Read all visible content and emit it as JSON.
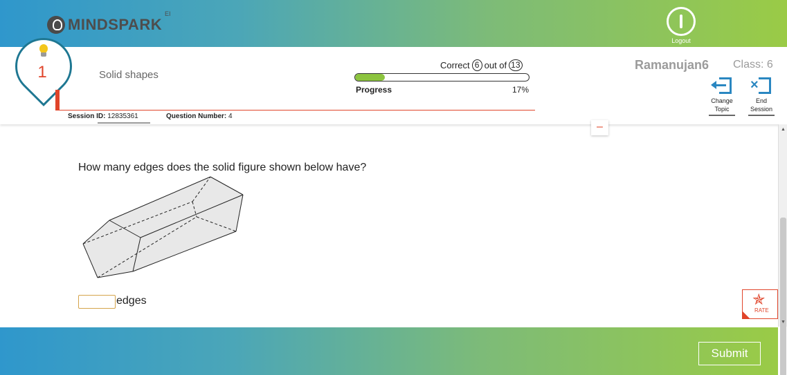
{
  "brand": {
    "name": "MINDSPARK",
    "superscript": "EI"
  },
  "header": {
    "logout_label": "Logout"
  },
  "topic": {
    "badge_number": "1",
    "name": "Solid shapes"
  },
  "session": {
    "session_label": "Session ID:",
    "session_id": "12835361",
    "question_label": "Question Number:",
    "question_number": "4"
  },
  "score": {
    "correct_label": "Correct",
    "correct": "6",
    "out_of_label": "out of",
    "total": "13"
  },
  "progress": {
    "label": "Progress",
    "percent_text": "17%",
    "fraction": 0.17
  },
  "user": {
    "name": "Ramanujan6",
    "class_text": "Class: 6"
  },
  "actions": {
    "change_topic_line1": "Change",
    "change_topic_line2": "Topic",
    "end_session_line1": "End",
    "end_session_line2": "Session"
  },
  "collapse_symbol": "–",
  "question": {
    "text": "How many edges does the solid figure shown below have?",
    "answer_value": "",
    "unit": "edges"
  },
  "rate": {
    "label": "RATE"
  },
  "footer": {
    "submit_label": "Submit"
  },
  "colors": {
    "accent_red": "#e0442a",
    "brand_blue": "#2a87c1",
    "progress_green": "#8cc43f",
    "answer_border": "#d4a34a"
  },
  "icons": [
    "bulb-icon",
    "power-icon",
    "change-topic-icon",
    "end-session-icon",
    "rate-star-icon"
  ]
}
